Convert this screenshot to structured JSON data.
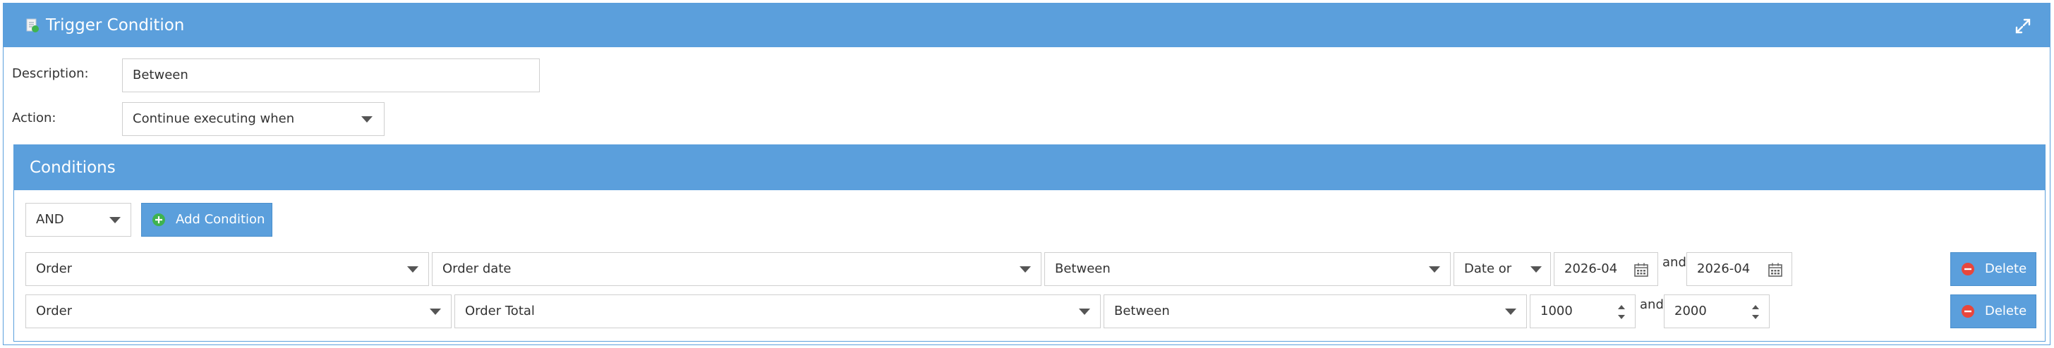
{
  "header": {
    "title": "Trigger Condition"
  },
  "form": {
    "description_label": "Description:",
    "description_value": "Between",
    "action_label": "Action:",
    "action_value": "Continue executing when"
  },
  "conditions": {
    "title": "Conditions",
    "logic_value": "AND",
    "add_label": "Add Condition",
    "and_label": "and",
    "delete_label": "Delete",
    "rows": [
      {
        "entity": "Order",
        "field": "Order date",
        "operator": "Between",
        "mode": "Date or",
        "from": "2026-04",
        "to": "2026-04"
      },
      {
        "entity": "Order",
        "field": "Order Total",
        "operator": "Between",
        "from": "1000",
        "to": "2000"
      }
    ]
  },
  "colors": {
    "accent": "#5b9fdc",
    "delete_icon": "#e8463c",
    "add_icon": "#3fb34f"
  }
}
